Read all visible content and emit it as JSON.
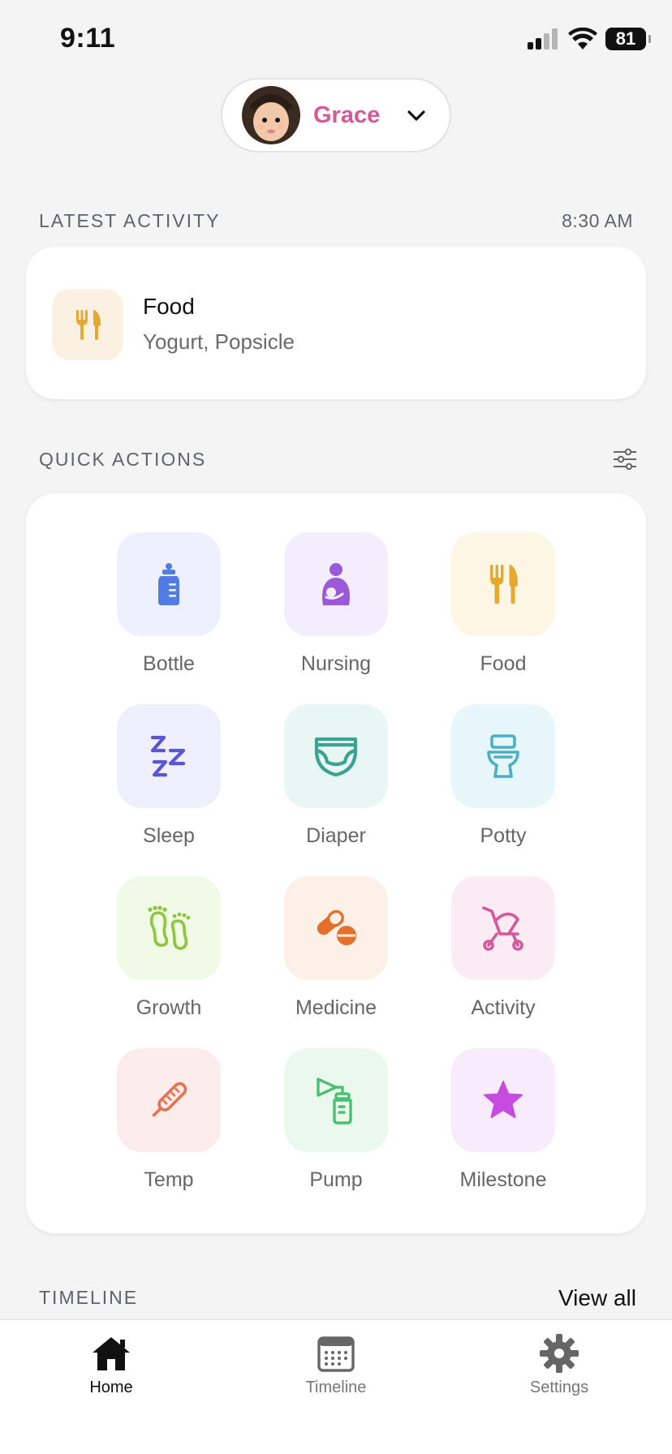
{
  "status_bar": {
    "time": "9:11",
    "battery": "81"
  },
  "profile": {
    "name": "Grace",
    "name_color": "#d6579a"
  },
  "latest_activity": {
    "label": "LATEST ACTIVITY",
    "time": "8:30 AM",
    "title": "Food",
    "subtitle": "Yogurt, Popsicle",
    "icon": "fork-knife-icon"
  },
  "quick_actions": {
    "label": "QUICK ACTIONS",
    "items": [
      {
        "label": "Bottle",
        "icon": "bottle-icon",
        "tile_color": "#eef1fd",
        "icon_color": "#4f7de3"
      },
      {
        "label": "Nursing",
        "icon": "nursing-icon",
        "tile_color": "#f3edfc",
        "icon_color": "#9b59d9"
      },
      {
        "label": "Food",
        "icon": "fork-knife-icon",
        "tile_color": "#fcf7e4",
        "icon_color": "#e4a92e"
      },
      {
        "label": "Sleep",
        "icon": "sleep-icon",
        "tile_color": "#efeffd",
        "icon_color": "#5b55d6"
      },
      {
        "label": "Diaper",
        "icon": "diaper-icon",
        "tile_color": "#e8f7f3",
        "icon_color": "#3aa391"
      },
      {
        "label": "Potty",
        "icon": "potty-icon",
        "tile_color": "#e7f6f8",
        "icon_color": "#4bafc7"
      },
      {
        "label": "Growth",
        "icon": "footprints-icon",
        "tile_color": "#f1f9e7",
        "icon_color": "#8cc63a"
      },
      {
        "label": "Medicine",
        "icon": "pills-icon",
        "tile_color": "#fdf0e6",
        "icon_color": "#e66f2b"
      },
      {
        "label": "Activity",
        "icon": "stroller-icon",
        "tile_color": "#fbecf3",
        "icon_color": "#d6579a"
      },
      {
        "label": "Temp",
        "icon": "thermometer-icon",
        "tile_color": "#fcecec",
        "icon_color": "#e8724e"
      },
      {
        "label": "Pump",
        "icon": "breast-pump-icon",
        "tile_color": "#eaf8ee",
        "icon_color": "#4cc071"
      },
      {
        "label": "Milestone",
        "icon": "star-icon",
        "tile_color": "#f7ebfc",
        "icon_color": "#c64be0"
      }
    ]
  },
  "timeline": {
    "label": "TIMELINE",
    "view_all": "View all"
  },
  "tab_bar": {
    "tabs": [
      {
        "label": "Home",
        "icon": "home-icon",
        "active": true
      },
      {
        "label": "Timeline",
        "icon": "calendar-icon",
        "active": false
      },
      {
        "label": "Settings",
        "icon": "gear-icon",
        "active": false
      }
    ]
  }
}
